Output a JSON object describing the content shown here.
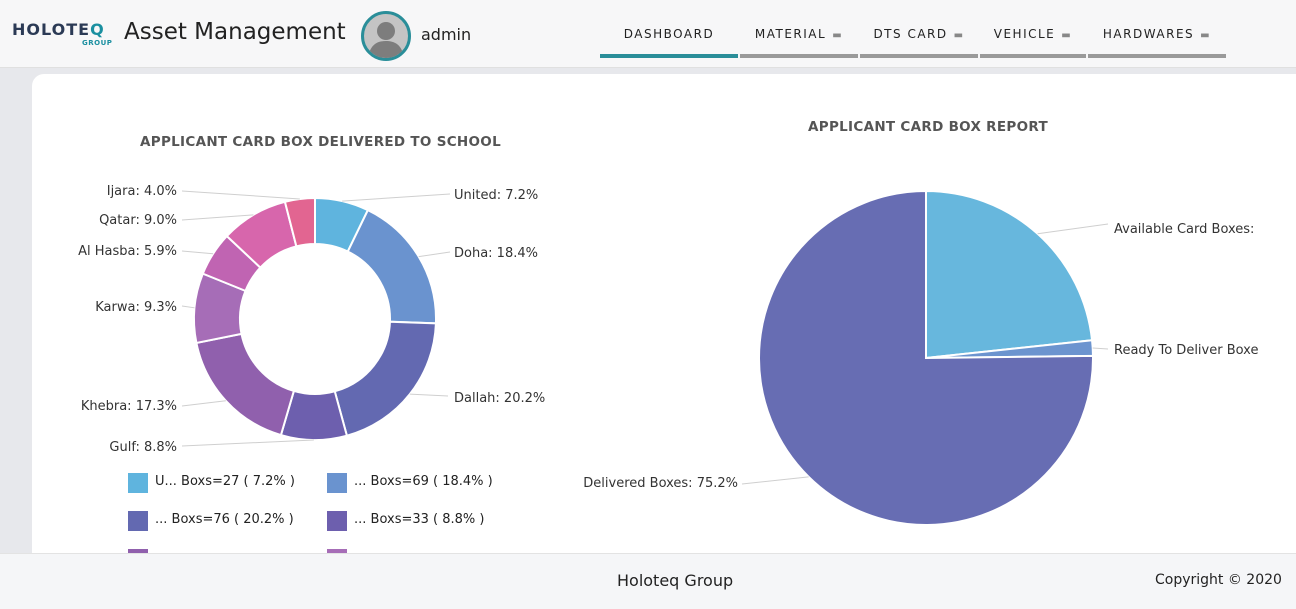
{
  "header": {
    "logo_text": "HOLOTEQ",
    "logo_sub": "GROUP",
    "app_title": "Asset Management",
    "username": "admin",
    "nav": [
      {
        "label": "DASHBOARD",
        "active": true,
        "has_caret": false
      },
      {
        "label": "MATERIAL",
        "active": false,
        "has_caret": true
      },
      {
        "label": "DTS CARD",
        "active": false,
        "has_caret": true
      },
      {
        "label": "VEHICLE",
        "active": false,
        "has_caret": true
      },
      {
        "label": "HARDWARES",
        "active": false,
        "has_caret": true
      }
    ]
  },
  "chart_data": [
    {
      "type": "pie",
      "variant": "donut",
      "title": "APPLICANT CARD BOX DELIVERED TO SCHOOL",
      "slices": [
        {
          "label": "United",
          "value": 7.2,
          "label_text": "United: 7.2%",
          "color": "#5fb4de"
        },
        {
          "label": "Doha",
          "value": 18.4,
          "label_text": "Doha: 18.4%",
          "color": "#6a93cf"
        },
        {
          "label": "Dallah",
          "value": 20.2,
          "label_text": "Dallah: 20.2%",
          "color": "#6369b1"
        },
        {
          "label": "Gulf",
          "value": 8.8,
          "label_text": "Gulf: 8.8%",
          "color": "#6d5fae"
        },
        {
          "label": "Khebra",
          "value": 17.3,
          "label_text": "Khebra: 17.3%",
          "color": "#9060ad"
        },
        {
          "label": "Karwa",
          "value": 9.3,
          "label_text": "Karwa: 9.3%",
          "color": "#a66db7"
        },
        {
          "label": "Al Hasba",
          "value": 5.9,
          "label_text": "Al Hasba: 5.9%",
          "color": "#c064b2"
        },
        {
          "label": "Qatar",
          "value": 9.0,
          "label_text": "Qatar: 9.0%",
          "color": "#d766ac"
        },
        {
          "label": "Ijara",
          "value": 4.0,
          "label_text": "Ijara: 4.0%",
          "color": "#e26591"
        }
      ],
      "legend": [
        {
          "text": "U... Boxs=27 ( 7.2% )",
          "color": "#5fb4de"
        },
        {
          "text": "... Boxs=69 ( 18.4% )",
          "color": "#6a93cf"
        },
        {
          "text": "... Boxs=76 ( 20.2% )",
          "color": "#6369b1"
        },
        {
          "text": "... Boxs=33 ( 8.8% )",
          "color": "#6d5fae"
        },
        {
          "text": "",
          "color": "#9060ad"
        },
        {
          "text": "",
          "color": "#a66db7"
        }
      ]
    },
    {
      "type": "pie",
      "title": "APPLICANT CARD BOX REPORT",
      "slices": [
        {
          "label": "Available Card Boxes",
          "value": 23.3,
          "label_text": "Available Card Boxes:",
          "color": "#67b7dd"
        },
        {
          "label": "Ready To Deliver Boxes",
          "value": 1.5,
          "label_text": "Ready To Deliver Boxe",
          "color": "#6c94cf"
        },
        {
          "label": "Delivered Boxes",
          "value": 75.2,
          "label_text": "Delivered Boxes: 75.2%",
          "color": "#676db3"
        }
      ]
    }
  ],
  "footer": {
    "center": "Holoteq Group",
    "copyright": "Copyright © 2020"
  }
}
